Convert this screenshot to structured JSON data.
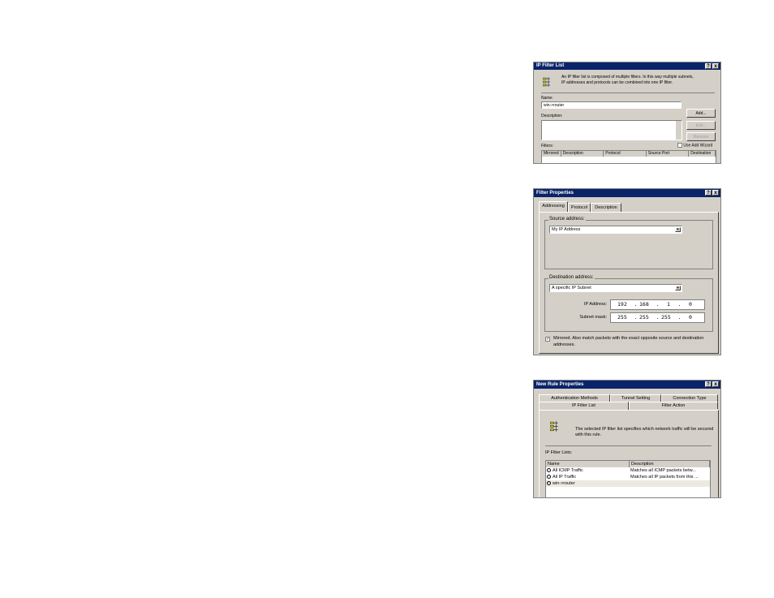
{
  "ip_filter_list": {
    "title": "IP Filter List",
    "help_btn": "?",
    "close_btn": "x",
    "intro": "An IP filter list is composed of multiple filters. In this way multiple subnets, IP addresses and protocols can be combined into one IP filter.",
    "name_label": "Name:",
    "name_value": "win->router",
    "description_label": "Description:",
    "add_label": "Add...",
    "edit_label": "Edit...",
    "remove_label": "Remove",
    "filters_label": "Filters:",
    "use_wizard_label": "Use Add Wizard",
    "columns": [
      "Mirrored",
      "Description",
      "Protocol",
      "Source Port",
      "Destination"
    ]
  },
  "filter_properties": {
    "title": "Filter Properties",
    "help_btn": "?",
    "close_btn": "x",
    "tabs": [
      "Addressing",
      "Protocol",
      "Description"
    ],
    "source_label": "Source address:",
    "source_value": "My IP Address",
    "dest_label": "Destination address:",
    "dest_value": "A specific IP Subnet",
    "ip_label": "IP Address:",
    "ip_octets": [
      "192",
      "168",
      "1",
      "0"
    ],
    "mask_label": "Subnet mask:",
    "mask_octets": [
      "255",
      "255",
      "255",
      "0"
    ],
    "mirrored_text": "Mirrored. Also match packets with the exact opposite source and destination addresses.",
    "mirrored_checked": true
  },
  "new_rule_properties": {
    "title": "New Rule Properties",
    "help_btn": "?",
    "close_btn": "x",
    "tabs_row1": [
      "Authentication Methods",
      "Tunnel Setting",
      "Connection Type"
    ],
    "tabs_row2": [
      "IP Filter List",
      "Filter Action"
    ],
    "intro": "The selected IP filter list specifies which network traffic will be secured with this rule.",
    "lists_label": "IP Filter Lists:",
    "columns": [
      "Name",
      "Description"
    ],
    "rows": [
      {
        "name": "All ICMP Traffic",
        "description": "Matches all ICMP packets betw..."
      },
      {
        "name": "All IP Traffic",
        "description": "Matches all IP packets from this ..."
      },
      {
        "name": "win->router",
        "description": ""
      }
    ]
  }
}
